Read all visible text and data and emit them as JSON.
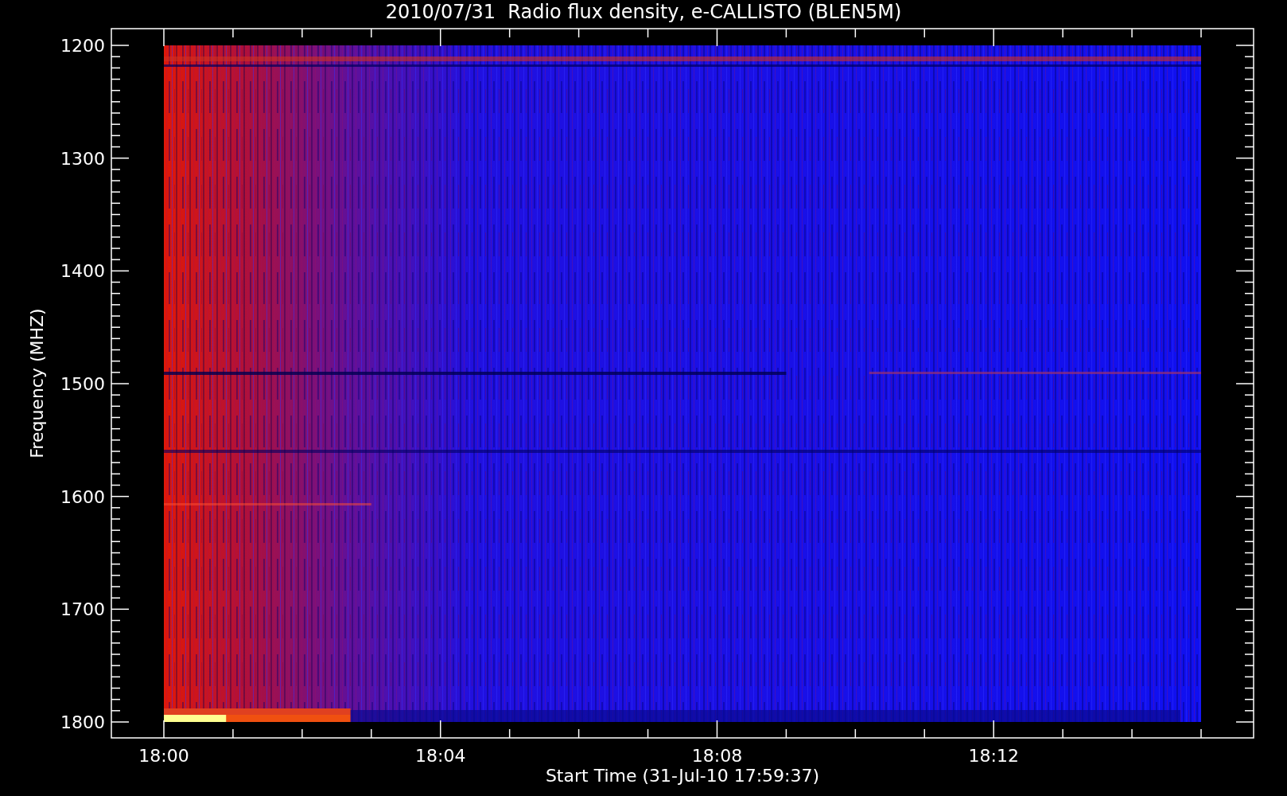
{
  "title": "2010/07/31  Radio flux density, e-CALLISTO (BLEN5M)",
  "y_axis": {
    "title": "Frequency (MHZ)",
    "ticks": [
      "1200",
      "1300",
      "1400",
      "1500",
      "1600",
      "1700",
      "1800"
    ]
  },
  "x_axis": {
    "title": "Start Time (31-Jul-10 17:59:37)",
    "ticks": [
      "18:00",
      "18:04",
      "18:08",
      "18:12"
    ]
  }
}
